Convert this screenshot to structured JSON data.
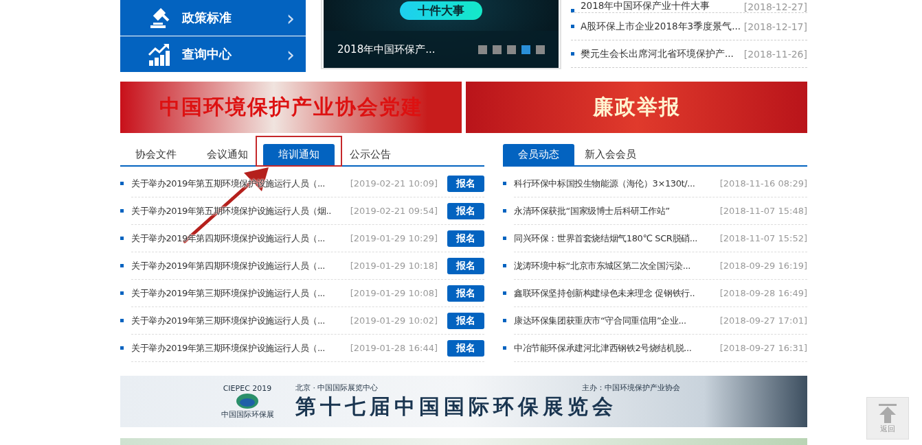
{
  "sidebar_menu": [
    {
      "label": "政策标准",
      "arrow": "›"
    },
    {
      "label": "查询中心",
      "arrow": "›"
    }
  ],
  "carousel": {
    "badge": "十件大事",
    "caption": "2018年中国环保产...",
    "dots": [
      {
        "selected": false
      },
      {
        "selected": false
      },
      {
        "selected": false
      },
      {
        "selected": true
      },
      {
        "selected": false
      }
    ]
  },
  "top_news": [
    {
      "title": "2018年中国环保产业十件大事",
      "date": "[2018-12-27]"
    },
    {
      "title": "A股环保上市企业2018年3季度景气...",
      "date": "[2018-12-17]"
    },
    {
      "title": "樊元生会长出席河北省环境保护产...",
      "date": "[2018-11-26]"
    }
  ],
  "banners": [
    {
      "kind": "party",
      "title": "中国环境保护产业协会党建"
    },
    {
      "kind": "integrity",
      "title": "廉政举报"
    }
  ],
  "notice_panel": {
    "tabs": [
      {
        "label": "协会文件",
        "selected": false
      },
      {
        "label": "会议通知",
        "selected": false
      },
      {
        "label": "培训通知",
        "selected": true
      },
      {
        "label": "公示公告",
        "selected": false
      }
    ],
    "items": [
      {
        "title": "关于举办2019年第五期环境保护设施运行人员（...",
        "date": "[2019-02-21 10:09]",
        "button": "报名"
      },
      {
        "title": "关于举办2019年第五期环境保护设施运行人员（烟..",
        "date": "[2019-02-21 09:54]",
        "button": "报名"
      },
      {
        "title": "关于举办2019年第四期环境保护设施运行人员（...",
        "date": "[2019-01-29 10:29]",
        "button": "报名"
      },
      {
        "title": "关于举办2019年第四期环境保护设施运行人员（...",
        "date": "[2019-01-29 10:18]",
        "button": "报名"
      },
      {
        "title": "关于举办2019年第三期环境保护设施运行人员（...",
        "date": "[2019-01-29 10:08]",
        "button": "报名"
      },
      {
        "title": "关于举办2019年第三期环境保护设施运行人员（...",
        "date": "[2019-01-29 10:02]",
        "button": "报名"
      },
      {
        "title": "关于举办2019年第三期环境保护设施运行人员（...",
        "date": "[2019-01-28 16:44]",
        "button": "报名"
      }
    ]
  },
  "member_panel": {
    "tabs": [
      {
        "label": "会员动态",
        "selected": true
      },
      {
        "label": "新入会会员",
        "selected": false
      }
    ],
    "items": [
      {
        "title": "科行环保中标国投生物能源（海伦）3×130t/...",
        "date": "[2018-11-16 08:29]"
      },
      {
        "title": "永清环保获批“国家级博士后科研工作站”",
        "date": "[2018-11-07 15:48]"
      },
      {
        "title": "同兴环保：世界首套烧结烟气180℃ SCR脱硝...",
        "date": "[2018-11-07 15:52]"
      },
      {
        "title": "泷涛环境中标“北京市东城区第二次全国污染...",
        "date": "[2018-09-29 16:19]"
      },
      {
        "title": "鑫联环保坚持创新构建绿色未来理念 促钢铁行..",
        "date": "[2018-09-28 16:49]"
      },
      {
        "title": "康达环保集团获重庆市“守合同重信用”企业...",
        "date": "[2018-09-27 17:01]"
      },
      {
        "title": "中冶节能环保承建河北津西钢铁2号烧结机脱...",
        "date": "[2018-09-27 16:31]"
      }
    ]
  },
  "expo_banner": {
    "logo_text": "CIEPEC 2019",
    "logo_caption": "中国国际环保展",
    "venue": "北京 · 中国国际展览中心",
    "organizer": "主办：中国环境保护产业协会",
    "title": "第十七届中国国际环保展览会"
  },
  "back_to_top": {
    "label": "返回"
  }
}
